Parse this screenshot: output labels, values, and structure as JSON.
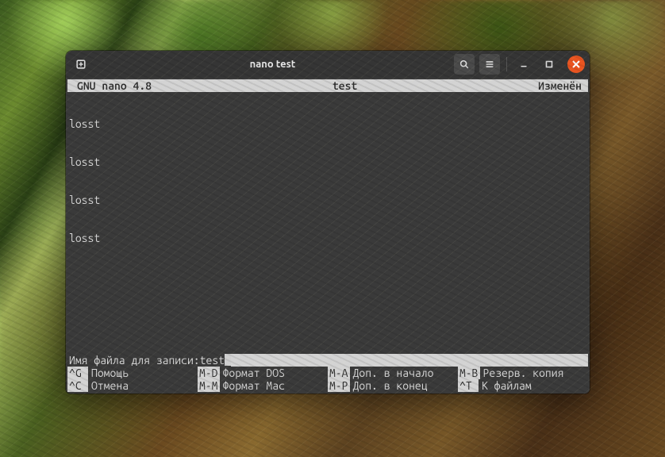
{
  "window": {
    "title": "nano test"
  },
  "nano": {
    "app_name": "GNU nano 4.8",
    "filename": "test",
    "status": "Изменён",
    "content_lines": [
      "losst",
      "losst",
      "losst",
      "losst"
    ],
    "prompt_label": "Имя файла для записи: ",
    "prompt_value": "test",
    "shortcuts_row1": [
      {
        "key": "^G",
        "label": "Помощь"
      },
      {
        "key": "M-D",
        "label": "Формат DOS"
      },
      {
        "key": "M-A",
        "label": "Доп. в начало"
      },
      {
        "key": "M-B",
        "label": "Резерв. копия"
      }
    ],
    "shortcuts_row2": [
      {
        "key": "^C",
        "label": "Отмена"
      },
      {
        "key": "M-M",
        "label": "Формат Mac"
      },
      {
        "key": "M-P",
        "label": "Доп. в конец"
      },
      {
        "key": "^T",
        "label": "К файлам"
      }
    ]
  }
}
